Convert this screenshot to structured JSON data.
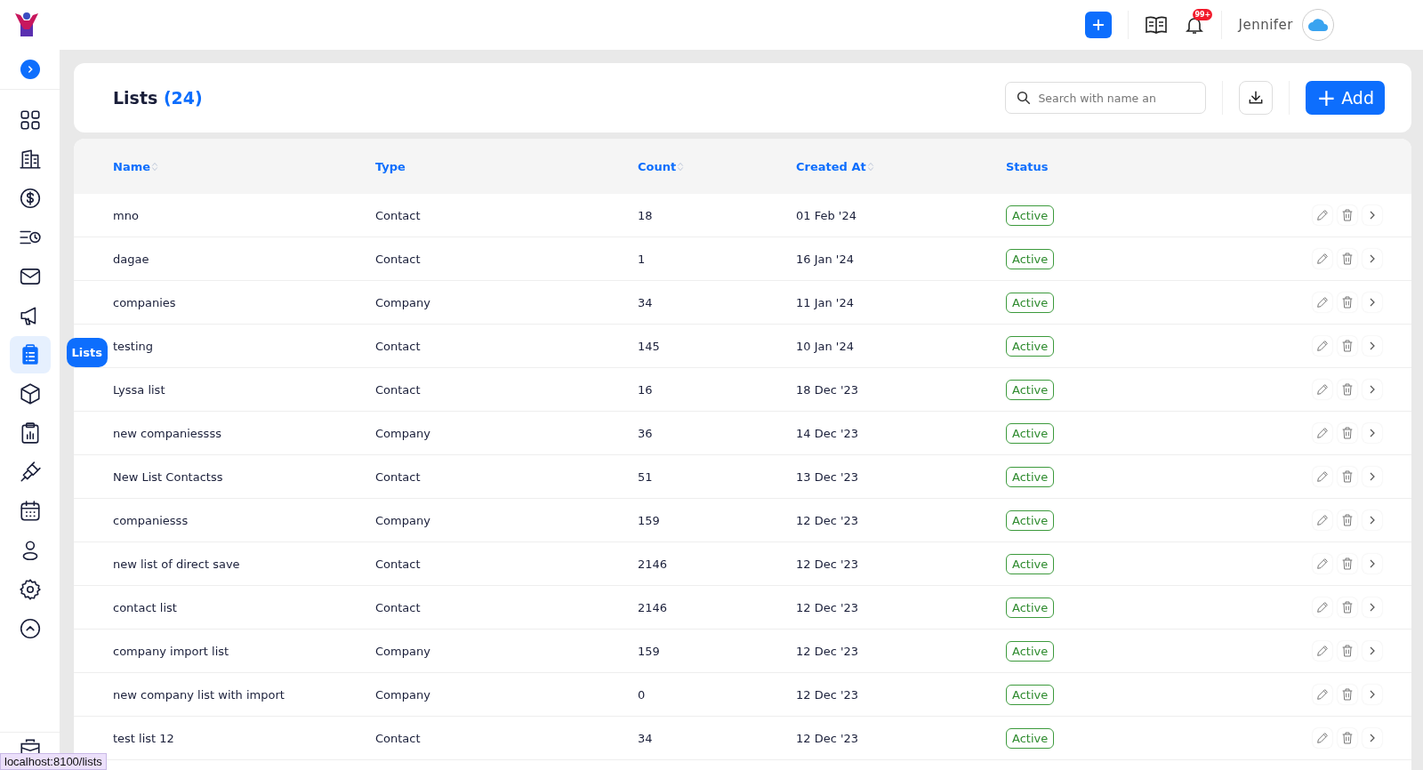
{
  "top_bar": {
    "notification_badge": "99+",
    "user_name": "Jennifer"
  },
  "sidebar": {
    "items": [
      {
        "selected": false
      },
      {
        "selected": false
      },
      {
        "selected": false
      },
      {
        "selected": false
      },
      {
        "selected": false
      },
      {
        "selected": false
      },
      {
        "selected": true
      },
      {
        "selected": false
      },
      {
        "selected": false
      },
      {
        "selected": false
      },
      {
        "selected": false
      },
      {
        "selected": false
      },
      {
        "selected": false
      },
      {
        "selected": false
      }
    ],
    "tooltip": "Lists"
  },
  "header": {
    "title": "Lists",
    "count": "(24)",
    "search": {
      "placeholder": "Search with name an"
    },
    "add_button": "Add",
    "add_icon": "+"
  },
  "table": {
    "columns": [
      {
        "label": "Name",
        "sortable": true
      },
      {
        "label": "Type",
        "sortable": false
      },
      {
        "label": "Count",
        "sortable": true
      },
      {
        "label": "Created At",
        "sortable": true
      },
      {
        "label": "Status",
        "sortable": false
      }
    ],
    "rows": [
      {
        "name": "mno",
        "type": "Contact",
        "count": "18",
        "created_at": "01 Feb '24",
        "status": "Active"
      },
      {
        "name": "dagae",
        "type": "Contact",
        "count": "1",
        "created_at": "16 Jan '24",
        "status": "Active"
      },
      {
        "name": "companies",
        "type": "Company",
        "count": "34",
        "created_at": "11 Jan '24",
        "status": "Active"
      },
      {
        "name": "testing",
        "type": "Contact",
        "count": "145",
        "created_at": "10 Jan '24",
        "status": "Active"
      },
      {
        "name": "Lyssa list",
        "type": "Contact",
        "count": "16",
        "created_at": "18 Dec '23",
        "status": "Active"
      },
      {
        "name": "new companiessss",
        "type": "Company",
        "count": "36",
        "created_at": "14 Dec '23",
        "status": "Active"
      },
      {
        "name": "New List Contactss",
        "type": "Contact",
        "count": "51",
        "created_at": "13 Dec '23",
        "status": "Active"
      },
      {
        "name": "companiesss",
        "type": "Company",
        "count": "159",
        "created_at": "12 Dec '23",
        "status": "Active"
      },
      {
        "name": "new list of direct save",
        "type": "Contact",
        "count": "2146",
        "created_at": "12 Dec '23",
        "status": "Active"
      },
      {
        "name": "contact list",
        "type": "Contact",
        "count": "2146",
        "created_at": "12 Dec '23",
        "status": "Active"
      },
      {
        "name": "company import list",
        "type": "Company",
        "count": "159",
        "created_at": "12 Dec '23",
        "status": "Active"
      },
      {
        "name": "new company list with import",
        "type": "Company",
        "count": "0",
        "created_at": "12 Dec '23",
        "status": "Active"
      },
      {
        "name": "test list 12",
        "type": "Contact",
        "count": "34",
        "created_at": "12 Dec '23",
        "status": "Active"
      }
    ]
  },
  "status_bar": {
    "url": "localhost:8100/lists"
  }
}
